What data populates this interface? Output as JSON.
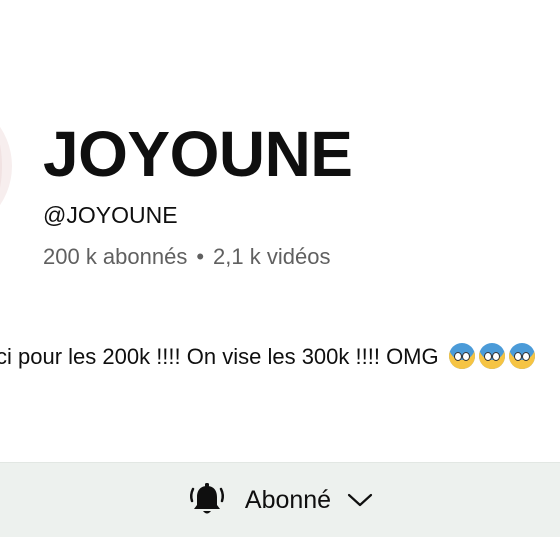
{
  "channel": {
    "name": "JOYOUNE",
    "handle": "@JOYOUNE",
    "subscribers": "200 k abonnés",
    "separator": "•",
    "videos": "2,1 k vidéos",
    "description": "ci pour les 200k  !!!! On vise les 300k !!!! OMG",
    "description_emoji": [
      "face-screaming-in-fear-emoji",
      "face-screaming-in-fear-emoji",
      "face-screaming-in-fear-emoji"
    ]
  },
  "subscribe_button": {
    "label": "Abonné",
    "bell_icon": "bell-ringing-icon",
    "chevron_icon": "chevron-down-icon"
  },
  "colors": {
    "text_primary": "#0f0f0f",
    "text_secondary": "#606060",
    "subscribe_bar_bg": "#edf1ee"
  }
}
